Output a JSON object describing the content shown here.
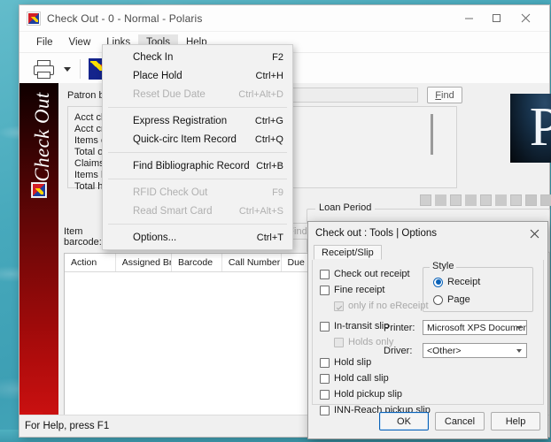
{
  "window": {
    "title": "Check Out - 0 - Normal - Polaris",
    "app_icon": "polaris-app-icon",
    "controls": {
      "minimize": "minimize-icon",
      "maximize": "maximize-icon",
      "close": "close-icon"
    }
  },
  "menubar": {
    "items": [
      "File",
      "View",
      "Links",
      "Tools",
      "Help"
    ],
    "open_index": 3
  },
  "toolbar": {
    "print_icon": "printer-icon",
    "print_caret": "chevron-down-icon",
    "checkout_icon": "check-out-icon"
  },
  "sidebar": {
    "label": "Check Out",
    "icon": "check-out-workform-icon"
  },
  "tools_menu": {
    "items": [
      {
        "label": "Check In",
        "accel": "F2",
        "disabled": false,
        "separator_after": false
      },
      {
        "label": "Place Hold",
        "accel": "Ctrl+H",
        "disabled": false,
        "separator_after": false
      },
      {
        "label": "Reset Due Date",
        "accel": "Ctrl+Alt+D",
        "disabled": true,
        "separator_after": true
      },
      {
        "label": "Express Registration",
        "accel": "Ctrl+G",
        "disabled": false,
        "separator_after": false
      },
      {
        "label": "Quick-circ Item Record",
        "accel": "Ctrl+Q",
        "disabled": false,
        "separator_after": true
      },
      {
        "label": "Find Bibliographic Record",
        "accel": "Ctrl+B",
        "disabled": false,
        "separator_after": true
      },
      {
        "label": "RFID Check Out",
        "accel": "F9",
        "disabled": true,
        "separator_after": false
      },
      {
        "label": "Read Smart Card",
        "accel": "Ctrl+Alt+S",
        "disabled": true,
        "separator_after": true
      },
      {
        "label": "Options...",
        "accel": "Ctrl+T",
        "disabled": false,
        "separator_after": false
      }
    ]
  },
  "patron": {
    "barcode_label": "Patron barcode:",
    "barcode_value": "",
    "find_label": "Find",
    "summary_rows": [
      "Acct charges:",
      "Acct credits:",
      "Items out:",
      "Total overdue:",
      "Claims/Lost:",
      "Items held:",
      "Total holds:"
    ]
  },
  "logo": {
    "letter": "P"
  },
  "mini_toolbar": {
    "icons": [
      "patron-status-icon",
      "blank-icon",
      "renew-icon",
      "blank-icon",
      "reading-history-icon",
      "blank-icon",
      "item-record-icon",
      "bookmark-icon",
      "edit-icon"
    ]
  },
  "loan_period": {
    "label": "Loan Period"
  },
  "item": {
    "barcode_label": "Item barcode:",
    "barcode_value": "",
    "find_label": "Find"
  },
  "grid": {
    "columns": [
      "Action",
      "Assigned Br ...",
      "Barcode",
      "Call Number",
      "Due Da"
    ]
  },
  "dialog": {
    "title": "Check out : Tools | Options",
    "close_icon": "close-icon",
    "tab": "Receipt/Slip",
    "checkboxes": [
      {
        "label": "Check out receipt",
        "checked": false,
        "disabled": false,
        "indent": 0
      },
      {
        "label": "Fine receipt",
        "checked": false,
        "disabled": false,
        "indent": 0
      },
      {
        "label": "only if no eReceipt",
        "checked": true,
        "disabled": true,
        "indent": 1
      },
      {
        "label": "In-transit slip",
        "checked": false,
        "disabled": false,
        "indent": 0
      },
      {
        "label": "Holds only",
        "checked": false,
        "disabled": true,
        "indent": 1
      },
      {
        "label": "Hold slip",
        "checked": false,
        "disabled": false,
        "indent": 0
      },
      {
        "label": "Hold call slip",
        "checked": false,
        "disabled": false,
        "indent": 0
      },
      {
        "label": "Hold pickup slip",
        "checked": false,
        "disabled": false,
        "indent": 0
      },
      {
        "label": "INN-Reach pickup slip",
        "checked": false,
        "disabled": false,
        "indent": 0
      }
    ],
    "style": {
      "legend": "Style",
      "options": [
        "Receipt",
        "Page"
      ],
      "selected": "Receipt"
    },
    "printer": {
      "label": "Printer:",
      "value": "Microsoft XPS Documen"
    },
    "driver": {
      "label": "Driver:",
      "value": "<Other>"
    },
    "buttons": {
      "ok": "OK",
      "cancel": "Cancel",
      "help": "Help"
    }
  },
  "statusbar": {
    "text": "For Help, press F1"
  },
  "colors": {
    "accent_red": "#cf1111",
    "accent_blue": "#0a62b8",
    "logo_navy": "#0a1520"
  }
}
